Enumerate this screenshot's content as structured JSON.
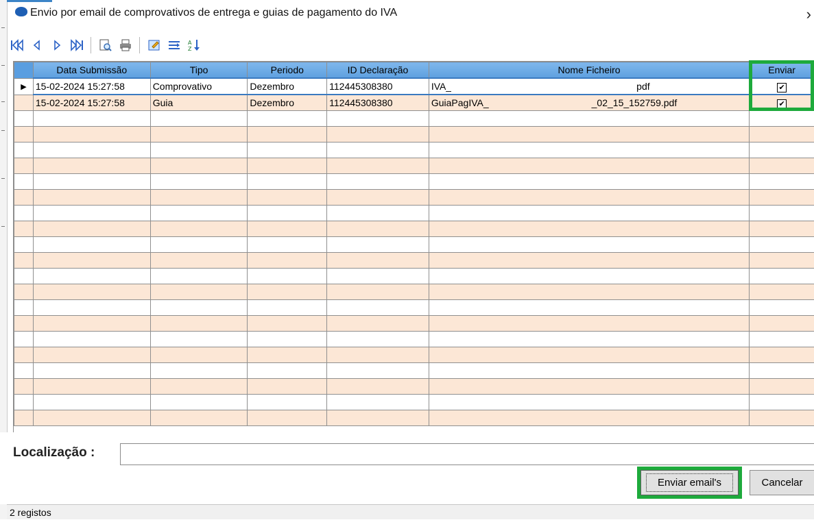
{
  "window": {
    "title": "Envio por email de comprovativos de entrega e guias de pagamento do IVA",
    "close_glyph": "›"
  },
  "toolbar": {
    "buttons": [
      {
        "name": "first-record-icon"
      },
      {
        "name": "prev-record-icon"
      },
      {
        "name": "next-record-icon"
      },
      {
        "name": "last-record-icon"
      },
      {
        "name": "preview-icon"
      },
      {
        "name": "print-icon"
      },
      {
        "name": "edit-form-icon"
      },
      {
        "name": "columns-icon"
      },
      {
        "name": "sort-icon"
      }
    ]
  },
  "grid": {
    "columns": [
      "Data Submissão",
      "Tipo",
      "Periodo",
      "ID Declaração",
      "Nome Ficheiro",
      "Enviar"
    ],
    "rows": [
      {
        "data": "15-02-2024 15:27:58",
        "tipo": "Comprovativo",
        "periodo": "Dezembro",
        "id": "112445308380",
        "ficheiro_prefix": "IVA_",
        "ficheiro_suffix": "pdf",
        "enviar": true,
        "selected": true
      },
      {
        "data": "15-02-2024 15:27:58",
        "tipo": "Guia",
        "periodo": "Dezembro",
        "id": "112445308380",
        "ficheiro_prefix": "GuiaPagIVA_",
        "ficheiro_suffix": "_02_15_152759.pdf",
        "enviar": true,
        "selected": false
      }
    ],
    "empty_rows": 20
  },
  "location": {
    "label": "Localização :",
    "value": ""
  },
  "actions": {
    "send": "Enviar email's",
    "cancel": "Cancelar"
  },
  "status": "2 registos",
  "colors": {
    "header": "#5ea0df",
    "row_alt": "#fce7d6",
    "highlight": "#1eaa3c"
  }
}
